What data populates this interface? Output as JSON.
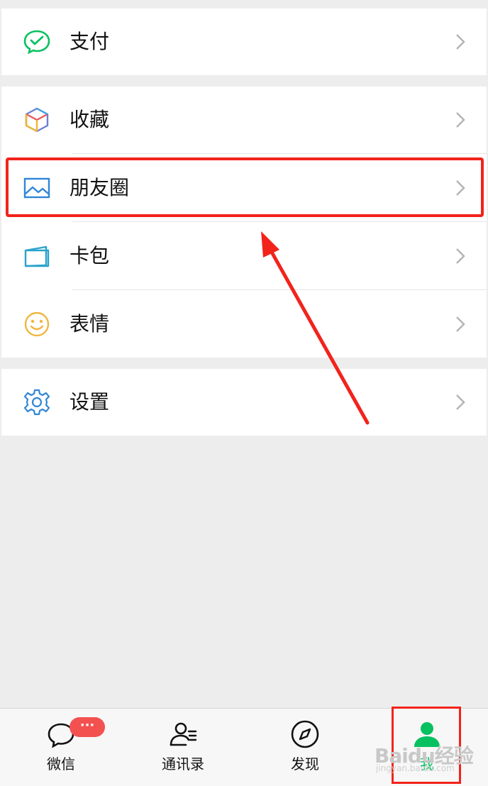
{
  "menu": {
    "pay": {
      "label": "支付",
      "icon": "pay-icon"
    },
    "favorites": {
      "label": "收藏",
      "icon": "favorites-cube-icon"
    },
    "moments": {
      "label": "朋友圈",
      "icon": "moments-image-icon"
    },
    "cards": {
      "label": "卡包",
      "icon": "card-wallet-icon"
    },
    "stickers": {
      "label": "表情",
      "icon": "smiley-icon"
    },
    "settings": {
      "label": "设置",
      "icon": "gear-icon"
    }
  },
  "tabbar": {
    "chats": {
      "label": "微信",
      "badge": "···",
      "icon": "chat-bubble-icon"
    },
    "contacts": {
      "label": "通讯录",
      "icon": "contacts-icon"
    },
    "discover": {
      "label": "发现",
      "icon": "compass-icon"
    },
    "me": {
      "label": "我",
      "icon": "person-icon",
      "active": true
    }
  },
  "watermark": {
    "text": "Baidu经验",
    "sub": "jingyan.baidu.com"
  },
  "colors": {
    "accent_green": "#07c160",
    "highlight_red": "#f2231b",
    "badge_red": "#f35150",
    "background": "#ededed"
  }
}
